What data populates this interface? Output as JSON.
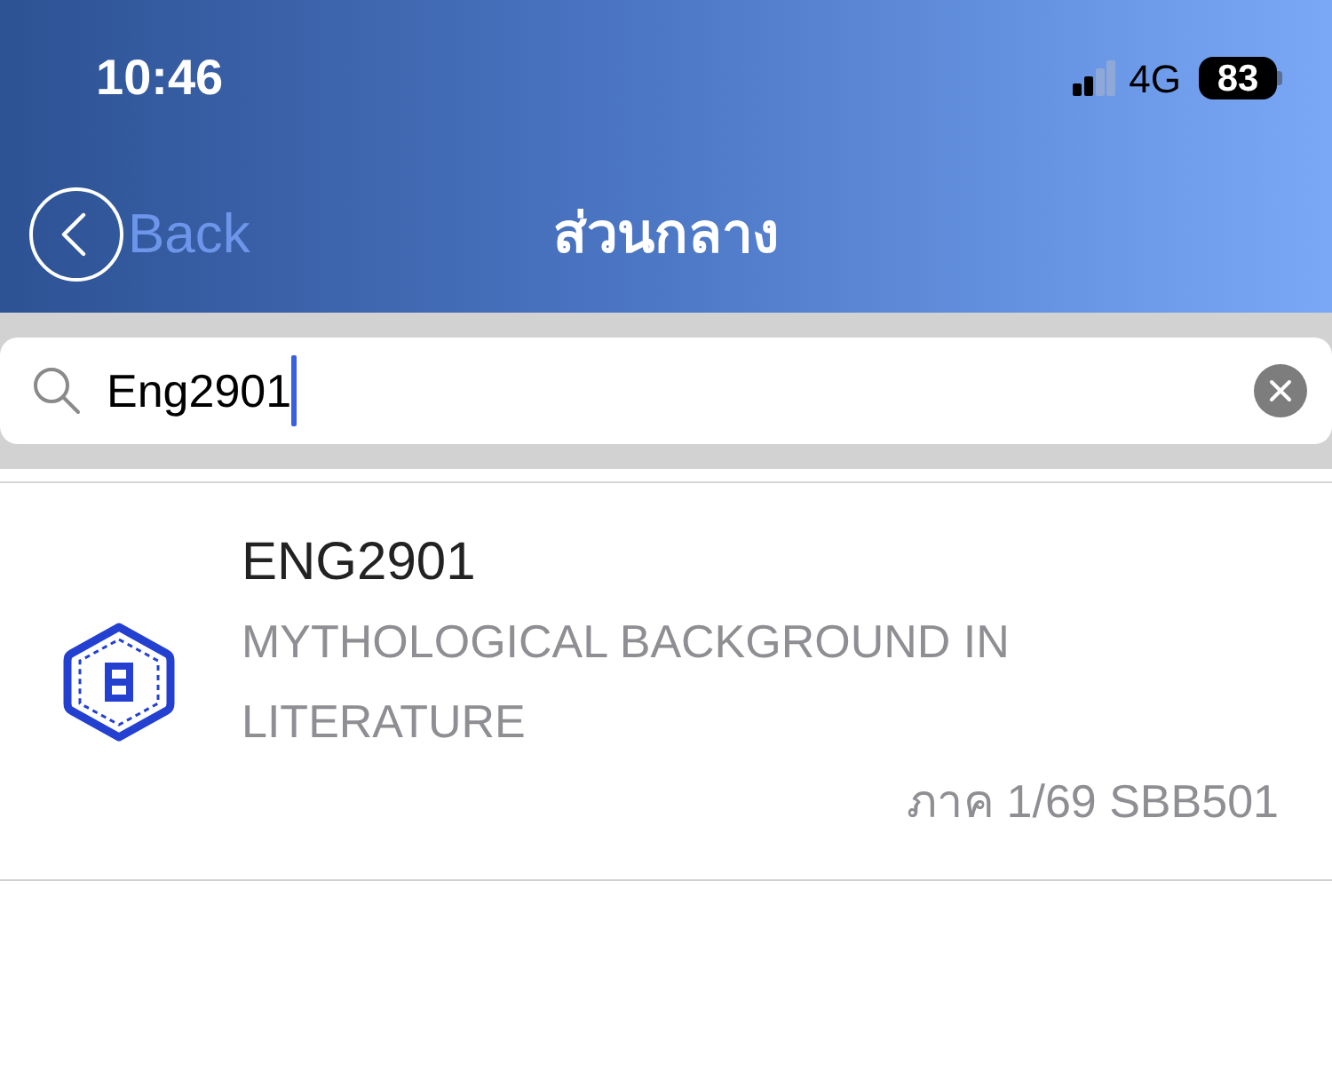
{
  "status_bar": {
    "time": "10:46",
    "network": "4G",
    "battery": "83"
  },
  "nav": {
    "back": "Back",
    "title": "ส่วนกลาง"
  },
  "search": {
    "value": "Eng2901",
    "focused": true
  },
  "results": [
    {
      "code": "ENG2901",
      "name": "MYTHOLOGICAL BACKGROUND IN LITERATURE",
      "detail": "ภาค 1/69 SBB501"
    }
  ]
}
